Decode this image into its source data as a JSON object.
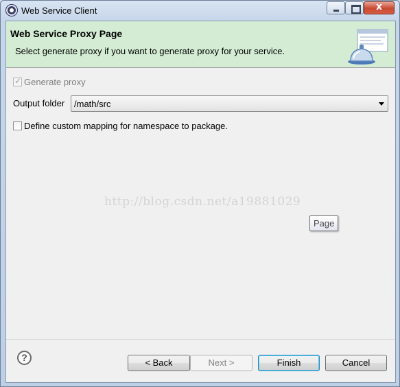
{
  "window": {
    "title": "Web Service Client",
    "close_glyph": "x"
  },
  "banner": {
    "title": "Web Service Proxy Page",
    "description": "Select generate proxy if you want to generate proxy for your service."
  },
  "form": {
    "generate_proxy": {
      "label": "Generate proxy",
      "checked": true,
      "enabled": false
    },
    "output_folder": {
      "label": "Output folder",
      "value": "/math/src"
    },
    "custom_mapping": {
      "label": "Define custom mapping for namespace to package.",
      "checked": false
    }
  },
  "watermark": "http://blog.csdn.net/a19881029",
  "tooltip": "Page",
  "footer": {
    "help_glyph": "?",
    "back_label": "< Back",
    "next_label": "Next >",
    "finish_label": "Finish",
    "cancel_label": "Cancel"
  },
  "colors": {
    "banner_bg": "#d3ecd3",
    "dialog_bg": "#f0f0f0",
    "default_button_border": "#3c7fb1"
  }
}
